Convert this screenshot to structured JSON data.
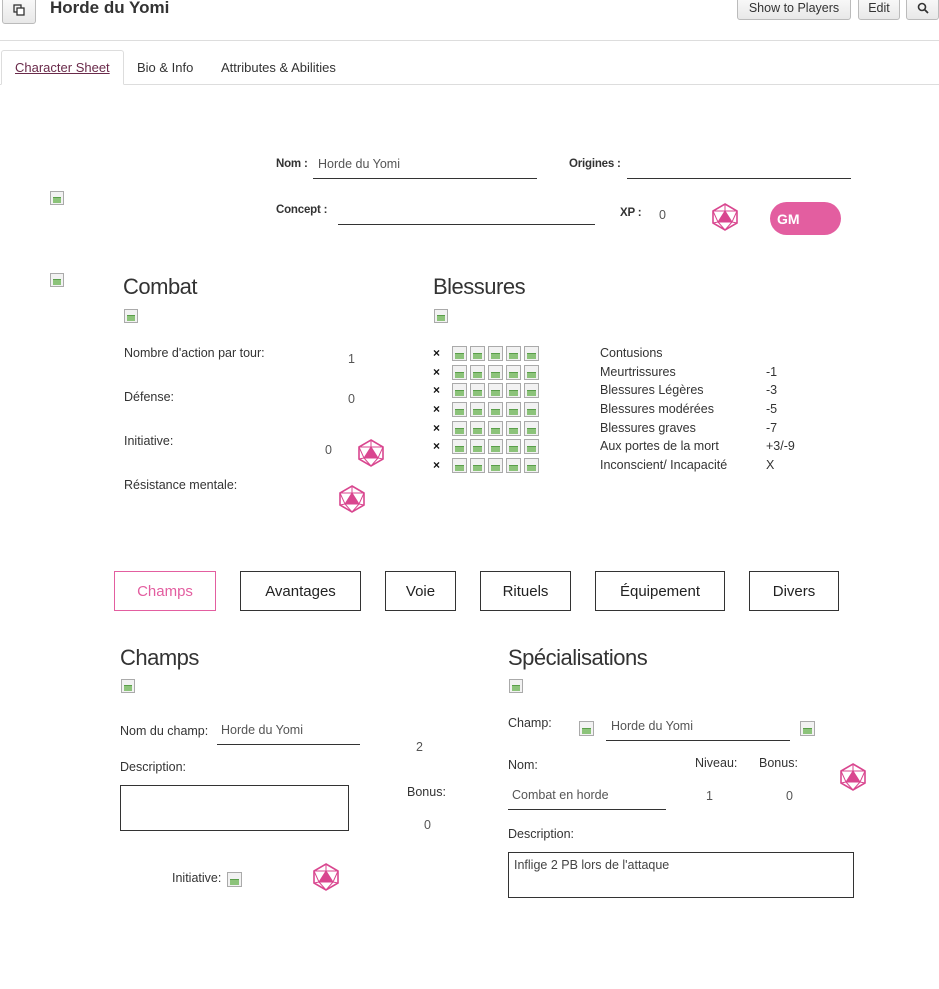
{
  "header": {
    "title": "Horde du Yomi",
    "show_players": "Show to Players",
    "edit": "Edit",
    "search_icon": "search-icon",
    "popout_icon": "popout-icon"
  },
  "tabs": [
    "Character Sheet",
    "Bio & Info",
    "Attributes & Abilities"
  ],
  "identity": {
    "nom_label": "Nom :",
    "nom_value": "Horde du Yomi",
    "origines_label": "Origines :",
    "origines_value": "",
    "concept_label": "Concept :",
    "concept_value": "",
    "xp_label": "XP :",
    "xp_value": "0",
    "gm_label": "GM"
  },
  "combat": {
    "title": "Combat",
    "actions_label": "Nombre d'action par tour:",
    "actions_value": "1",
    "defense_label": "Défense:",
    "defense_value": "0",
    "initiative_label": "Initiative:",
    "initiative_value": "0",
    "resistance_label": "Résistance mentale:"
  },
  "blessures": {
    "title": "Blessures",
    "levels": [
      {
        "name": "Contusions",
        "malus": ""
      },
      {
        "name": "Meurtrissures",
        "malus": "-1"
      },
      {
        "name": "Blessures Légères",
        "malus": "-3"
      },
      {
        "name": "Blessures modérées",
        "malus": "-5"
      },
      {
        "name": "Blessures graves",
        "malus": "-7"
      },
      {
        "name": "Aux portes de la mort",
        "malus": "+3/-9"
      },
      {
        "name": "Inconscient/ Incapacité",
        "malus": "X"
      }
    ],
    "clear_mark": "×"
  },
  "sheet_tabs": [
    "Champs",
    "Avantages",
    "Voie",
    "Rituels",
    "Équipement",
    "Divers"
  ],
  "champs": {
    "title": "Champs",
    "nom_label": "Nom du champ:",
    "nom_value": "Horde du Yomi",
    "value": "2",
    "description_label": "Description:",
    "description_value": "",
    "bonus_label": "Bonus:",
    "bonus_value": "0",
    "initiative_label": "Initiative:"
  },
  "specialisations": {
    "title": "Spécialisations",
    "champ_label": "Champ:",
    "champ_value": "Horde du Yomi",
    "nom_label": "Nom:",
    "niveau_label": "Niveau:",
    "bonus_label": "Bonus:",
    "nom_value": "Combat en horde",
    "niveau_value": "1",
    "bonus_value": "0",
    "description_label": "Description:",
    "description_value": "Inflige 2 PB lors de l'attaque"
  },
  "colors": {
    "accent": "#e35ea0",
    "dice": "#d9468f"
  }
}
